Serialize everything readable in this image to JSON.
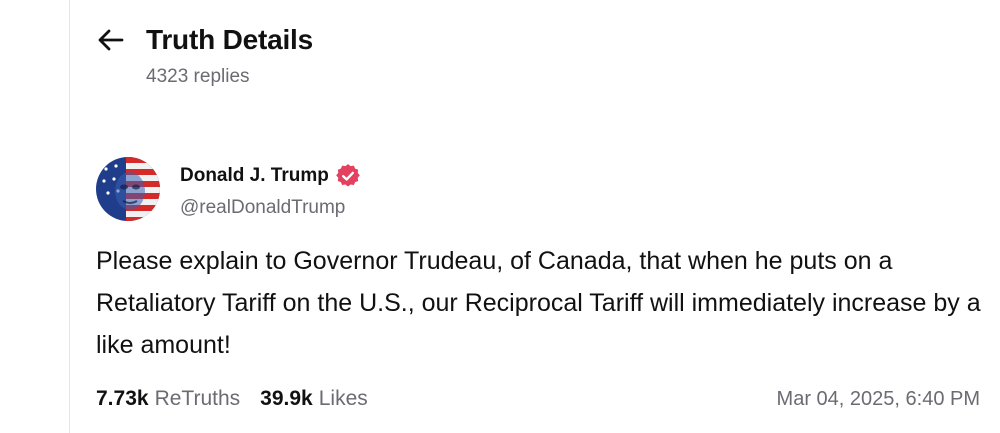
{
  "header": {
    "back_icon": "arrow-left-icon",
    "title": "Truth Details",
    "reply_count": "4323 replies"
  },
  "post": {
    "author": {
      "display_name": "Donald J. Trump",
      "handle": "@realDonaldTrump",
      "verified_icon": "verified-badge-icon",
      "verified_color": "#e4405f"
    },
    "body": "Please explain to Governor Trudeau, of Canada, that when he puts on a Retaliatory Tariff on the U.S., our Reciprocal Tariff will immediately increase by a like amount!",
    "stats": {
      "retruths_value": "7.73k",
      "retruths_label": "ReTruths",
      "likes_value": "39.9k",
      "likes_label": "Likes"
    },
    "timestamp": "Mar 04, 2025, 6:40 PM"
  }
}
